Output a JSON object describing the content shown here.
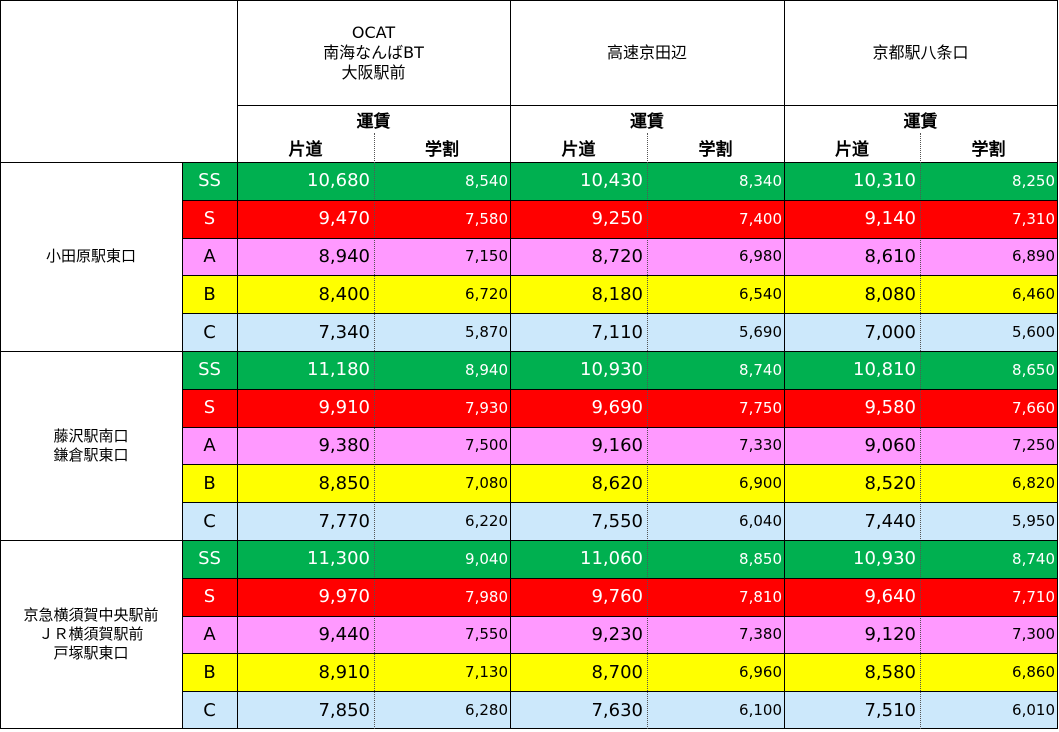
{
  "header": {
    "destinations": [
      {
        "lines": [
          "OCAT",
          "南海なんばBT",
          "大阪駅前"
        ]
      },
      {
        "lines": [
          "高速京田辺"
        ]
      },
      {
        "lines": [
          "京都駅八条口"
        ]
      }
    ],
    "fare_label": "運賃",
    "oneway_label": "片道",
    "student_label": "学割"
  },
  "colors": {
    "SS": "#00b050",
    "S": "#ff0000",
    "A": "#ff99ff",
    "B": "#ffff00",
    "C": "#cce8fb"
  },
  "groups": [
    {
      "origin_lines": [
        "小田原駅東口"
      ],
      "rows": [
        {
          "rank": "SS",
          "fares": [
            [
              "10,680",
              "8,540"
            ],
            [
              "10,430",
              "8,340"
            ],
            [
              "10,310",
              "8,250"
            ]
          ]
        },
        {
          "rank": "S",
          "fares": [
            [
              "9,470",
              "7,580"
            ],
            [
              "9,250",
              "7,400"
            ],
            [
              "9,140",
              "7,310"
            ]
          ]
        },
        {
          "rank": "A",
          "fares": [
            [
              "8,940",
              "7,150"
            ],
            [
              "8,720",
              "6,980"
            ],
            [
              "8,610",
              "6,890"
            ]
          ]
        },
        {
          "rank": "B",
          "fares": [
            [
              "8,400",
              "6,720"
            ],
            [
              "8,180",
              "6,540"
            ],
            [
              "8,080",
              "6,460"
            ]
          ]
        },
        {
          "rank": "C",
          "fares": [
            [
              "7,340",
              "5,870"
            ],
            [
              "7,110",
              "5,690"
            ],
            [
              "7,000",
              "5,600"
            ]
          ]
        }
      ]
    },
    {
      "origin_lines": [
        "藤沢駅南口",
        "鎌倉駅東口"
      ],
      "rows": [
        {
          "rank": "SS",
          "fares": [
            [
              "11,180",
              "8,940"
            ],
            [
              "10,930",
              "8,740"
            ],
            [
              "10,810",
              "8,650"
            ]
          ]
        },
        {
          "rank": "S",
          "fares": [
            [
              "9,910",
              "7,930"
            ],
            [
              "9,690",
              "7,750"
            ],
            [
              "9,580",
              "7,660"
            ]
          ]
        },
        {
          "rank": "A",
          "fares": [
            [
              "9,380",
              "7,500"
            ],
            [
              "9,160",
              "7,330"
            ],
            [
              "9,060",
              "7,250"
            ]
          ]
        },
        {
          "rank": "B",
          "fares": [
            [
              "8,850",
              "7,080"
            ],
            [
              "8,620",
              "6,900"
            ],
            [
              "8,520",
              "6,820"
            ]
          ]
        },
        {
          "rank": "C",
          "fares": [
            [
              "7,770",
              "6,220"
            ],
            [
              "7,550",
              "6,040"
            ],
            [
              "7,440",
              "5,950"
            ]
          ]
        }
      ]
    },
    {
      "origin_lines": [
        "京急横須賀中央駅前",
        "ＪＲ横須賀駅前",
        "戸塚駅東口"
      ],
      "rows": [
        {
          "rank": "SS",
          "fares": [
            [
              "11,300",
              "9,040"
            ],
            [
              "11,060",
              "8,850"
            ],
            [
              "10,930",
              "8,740"
            ]
          ]
        },
        {
          "rank": "S",
          "fares": [
            [
              "9,970",
              "7,980"
            ],
            [
              "9,760",
              "7,810"
            ],
            [
              "9,640",
              "7,710"
            ]
          ]
        },
        {
          "rank": "A",
          "fares": [
            [
              "9,440",
              "7,550"
            ],
            [
              "9,230",
              "7,380"
            ],
            [
              "9,120",
              "7,300"
            ]
          ]
        },
        {
          "rank": "B",
          "fares": [
            [
              "8,910",
              "7,130"
            ],
            [
              "8,700",
              "6,960"
            ],
            [
              "8,580",
              "6,860"
            ]
          ]
        },
        {
          "rank": "C",
          "fares": [
            [
              "7,850",
              "6,280"
            ],
            [
              "7,630",
              "6,100"
            ],
            [
              "7,510",
              "6,010"
            ]
          ]
        }
      ]
    }
  ]
}
